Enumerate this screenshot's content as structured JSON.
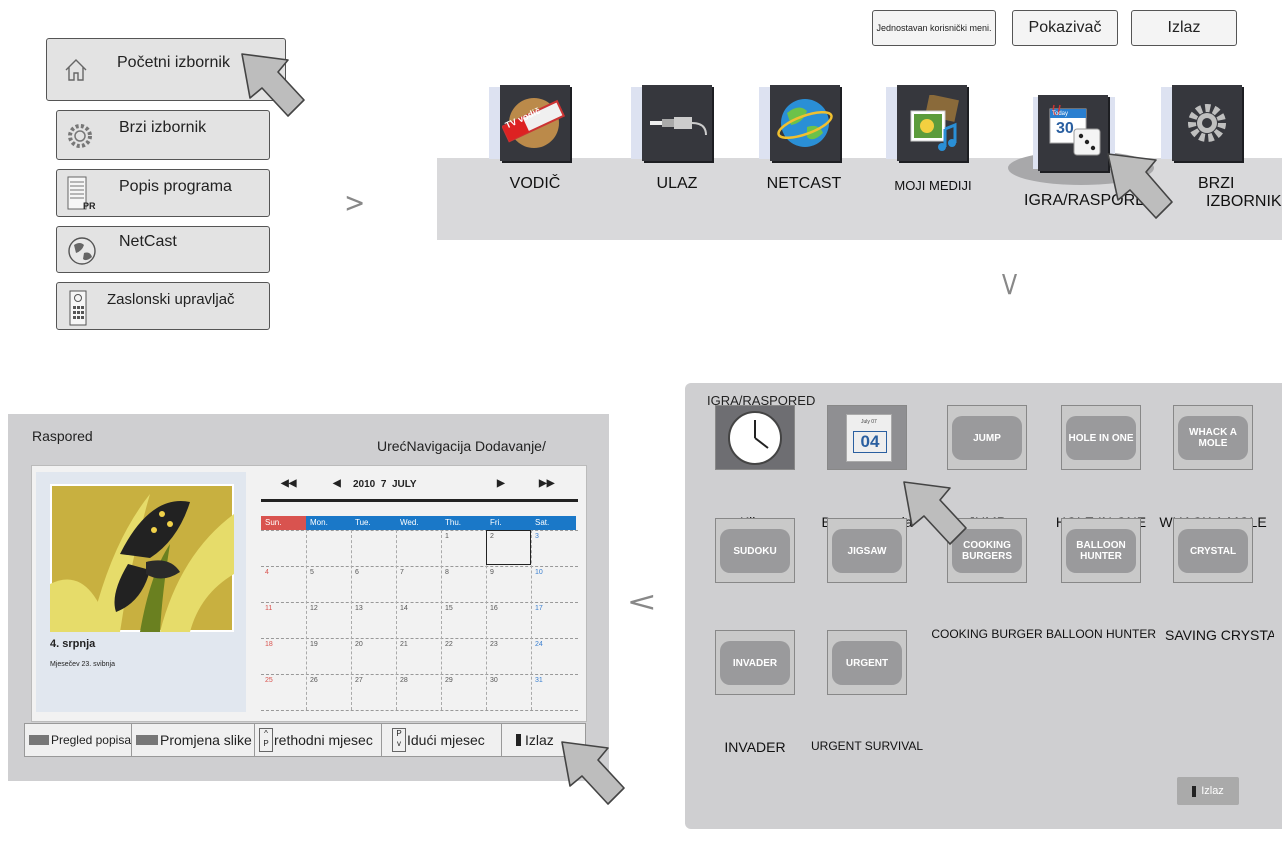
{
  "home_menu": {
    "items": [
      {
        "label": "Početni izbornik",
        "icon": "home-icon"
      },
      {
        "label": "Brzi izbornik",
        "icon": "gear-icon"
      },
      {
        "label": "Popis programa",
        "icon": "program-list-icon",
        "badge": "PR"
      },
      {
        "label": "NetCast",
        "icon": "globe-icon"
      },
      {
        "label": "Zaslonski upravljač",
        "icon": "remote-icon"
      }
    ]
  },
  "top_buttons": {
    "simple_menu": "Jednostavan korisnički meni.",
    "pointer": "Pokazivač",
    "exit": "Izlaz"
  },
  "launcher": {
    "apps": [
      {
        "label": "VODIČ",
        "icon": "tv-guide-icon",
        "icon_text": "TV vodič"
      },
      {
        "label": "ULAZ",
        "icon": "input-cable-icon"
      },
      {
        "label": "NETCAST",
        "icon": "globe-icon"
      },
      {
        "label": "MOJI MEDIJI",
        "icon": "media-icon"
      },
      {
        "label": "IGRA/RASPORED",
        "icon": "calendar-dice-icon",
        "icon_text_today": "Today",
        "icon_text_day": "30"
      },
      {
        "label_line1": "BRZI",
        "label_line2": "IZBORNIK",
        "icon": "gear-icon"
      }
    ]
  },
  "arrows": {
    "right": ">",
    "down": "V",
    "left": "<"
  },
  "schedule": {
    "title": "Raspored",
    "header_overlap": "UrećNavigacija Dodavanje/",
    "date_label": "4. srpnja",
    "lunar_label": "Mjesečev 23. svibnja",
    "month_nav": {
      "year": "2010",
      "month_num": "7",
      "month_name": "JULY"
    },
    "weekdays": [
      "Sun.",
      "Mon.",
      "Tue.",
      "Wed.",
      "Thu.",
      "Fri.",
      "Sat."
    ],
    "weeks": [
      [
        "",
        "",
        "",
        "",
        "1",
        "2",
        "3"
      ],
      [
        "4",
        "5",
        "6",
        "7",
        "8",
        "9",
        "10"
      ],
      [
        "11",
        "12",
        "13",
        "14",
        "15",
        "16",
        "17"
      ],
      [
        "18",
        "19",
        "20",
        "21",
        "22",
        "23",
        "24"
      ],
      [
        "25",
        "26",
        "27",
        "28",
        "29",
        "30",
        "31"
      ]
    ],
    "selected_day": "2",
    "bottom_bar": {
      "list_view": "Pregled popisa",
      "change_image": "Promjena slike",
      "prev_month": "rethodni mjesec",
      "next_month": "Idući mjesec",
      "exit": "Izlaz"
    },
    "colors": {
      "header_blue": "#1a78c8",
      "sunday_red": "#d9534f",
      "saturday_blue": "#3a7fd0"
    }
  },
  "games": {
    "title": "IGRA/RASPORED",
    "items": [
      {
        "label": "Kijev",
        "icon": "clock-icon"
      },
      {
        "label": "Bez rasporeda",
        "icon": "calendar-icon",
        "icon_text_month": "July 07",
        "icon_text_day": "04"
      },
      {
        "label": "JUMP",
        "icon_text": "JUMP"
      },
      {
        "label": "HOLE IN ONE",
        "icon_text": "HOLE IN ONE"
      },
      {
        "label": "WHACK A MOLE",
        "icon_text": "WHACK A MOLE"
      },
      {
        "label": "SUDOKU",
        "icon_text": "SUDOKU"
      },
      {
        "label": "JIGSAW",
        "icon_text": "JIGSAW"
      },
      {
        "label": "COOKING BURGER",
        "icon_text": "COOKING BURGERS"
      },
      {
        "label": "BALLOON HUNTER",
        "icon_text": "BALLOON HUNTER"
      },
      {
        "label": "SAVING CRYSTA",
        "icon_text": "CRYSTAL"
      },
      {
        "label": "INVADER",
        "icon_text": "INVADER"
      },
      {
        "label": "URGENT SURVIVAL",
        "icon_text": "URGENT"
      }
    ],
    "exit": "Izlaz"
  }
}
